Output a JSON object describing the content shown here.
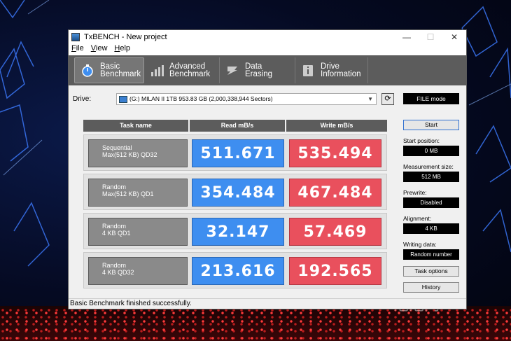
{
  "window": {
    "title": "TxBENCH - New project"
  },
  "window_controls": {
    "minimize": "—",
    "maximize": "☐",
    "close": "✕"
  },
  "menu": [
    {
      "label": "File",
      "key": "F",
      "rest": "ile"
    },
    {
      "label": "View",
      "key": "V",
      "rest": "iew"
    },
    {
      "label": "Help",
      "key": "H",
      "rest": "elp"
    }
  ],
  "toolbar": {
    "tabs": [
      {
        "line1": "Basic",
        "line2": "Benchmark",
        "icon": "stopwatch-icon",
        "active": true
      },
      {
        "line1": "Advanced",
        "line2": "Benchmark",
        "icon": "bar-chart-icon",
        "active": false
      },
      {
        "line1": "Data Erasing",
        "line2": "",
        "icon": "eraser-icon",
        "active": false
      },
      {
        "line1": "Drive",
        "line2": "Information",
        "icon": "info-icon",
        "active": false
      }
    ]
  },
  "drive": {
    "label": "Drive:",
    "selected": "(G:) MILAN II 1TB  953.83 GB (2,000,338,944 Sectors)",
    "mode": "FILE mode"
  },
  "table": {
    "headers": {
      "task": "Task name",
      "read": "Read mB/s",
      "write": "Write mB/s"
    },
    "rows": [
      {
        "line1": "Sequential",
        "line2": "Max(512 KB) QD32",
        "read": "511.671",
        "write": "535.494"
      },
      {
        "line1": "Random",
        "line2": "Max(512 KB) QD1",
        "read": "354.484",
        "write": "467.484"
      },
      {
        "line1": "Random",
        "line2": "4 KB QD1",
        "read": "32.147",
        "write": "57.469"
      },
      {
        "line1": "Random",
        "line2": "4 KB QD32",
        "read": "213.616",
        "write": "192.565"
      }
    ]
  },
  "settings": {
    "start_button": "Start",
    "start_position_label": "Start position:",
    "start_position_value": "0 MB",
    "measurement_size_label": "Measurement size:",
    "measurement_size_value": "512 MB",
    "prewrite_label": "Prewrite:",
    "prewrite_value": "Disabled",
    "alignment_label": "Alignment:",
    "alignment_value": "4 KB",
    "writing_data_label": "Writing data:",
    "writing_data_value": "Random number",
    "task_options_button": "Task options",
    "history_button": "History"
  },
  "status_bar": "Basic Benchmark finished successfully.",
  "watermark": "泡泡网",
  "colors": {
    "read": "#3e8ef0",
    "write": "#e9505d",
    "toolbar": "#5c5c5c"
  }
}
